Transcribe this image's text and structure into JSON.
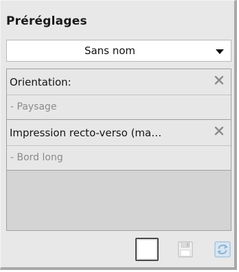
{
  "presets": {
    "title": "Préréglages",
    "selected": "Sans nom"
  },
  "settings_list": {
    "items": [
      {
        "title": "Orientation:",
        "value": "- Paysage"
      },
      {
        "title": "Impression recto-verso (ma…",
        "value": "- Bord long"
      }
    ]
  },
  "toolbar": {
    "buttons": [
      {
        "icon": "new-document-icon",
        "enabled": true
      },
      {
        "icon": "save-icon",
        "enabled": false
      },
      {
        "icon": "refresh-icon",
        "enabled": false
      }
    ]
  },
  "colors": {
    "panel_bg": "#e8e8e8",
    "list_bg": "#d4d4d4",
    "item_bg": "#e7e7e7",
    "disabled_icon": "#a9c6dd"
  }
}
